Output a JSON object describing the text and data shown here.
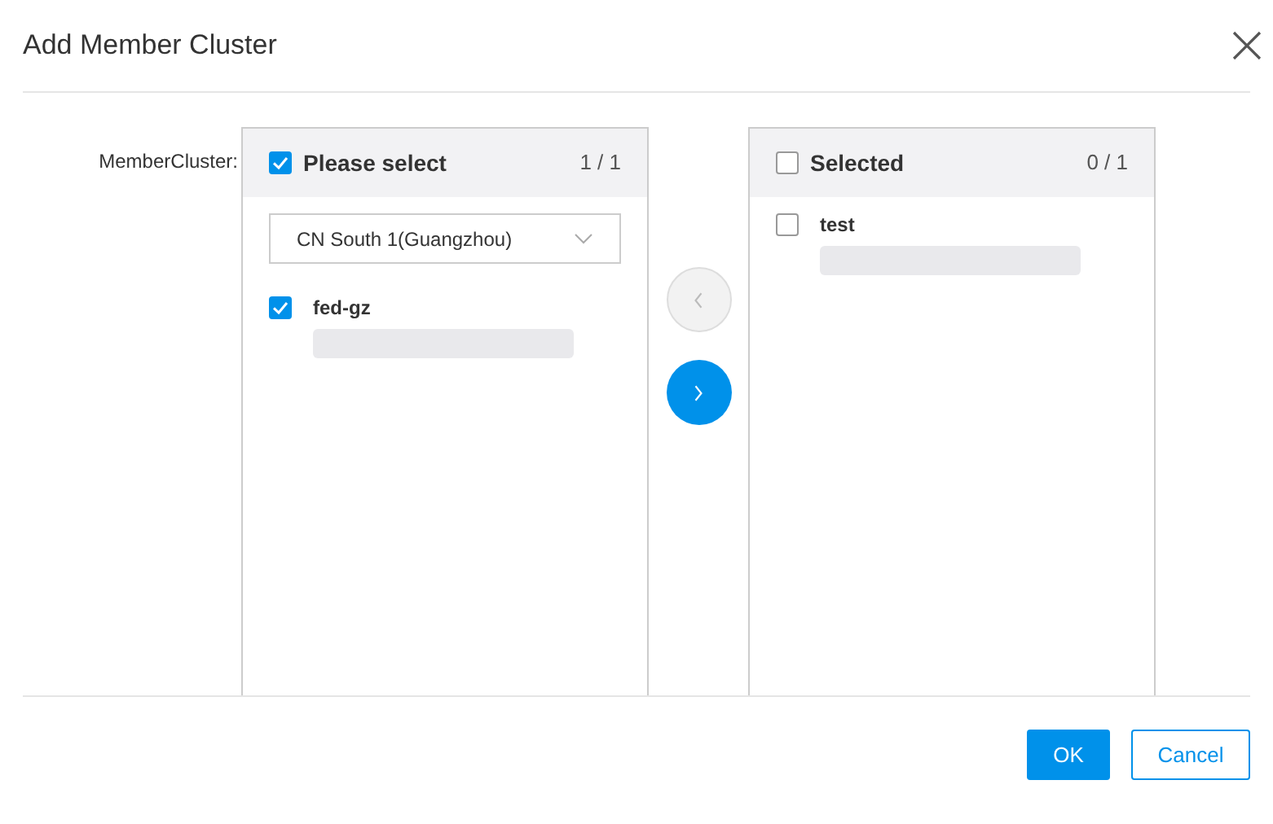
{
  "dialog": {
    "title": "Add Member Cluster"
  },
  "field_label": "MemberCluster:",
  "source": {
    "title": "Please select",
    "checked": true,
    "count": "1 / 1",
    "region": "CN South 1(Guangzhou)",
    "items": [
      {
        "name": "fed-gz",
        "checked": true
      }
    ]
  },
  "move_buttons": [
    {
      "kind": "left",
      "disabled": true
    },
    {
      "kind": "right",
      "disabled": false
    }
  ],
  "target": {
    "title": "Selected",
    "checked": false,
    "count": "0 / 1",
    "items": [
      {
        "name": "test",
        "checked": false
      }
    ]
  },
  "buttons": [
    {
      "label": "OK",
      "kind": "primary"
    },
    {
      "label": "Cancel",
      "kind": "secondary"
    }
  ]
}
